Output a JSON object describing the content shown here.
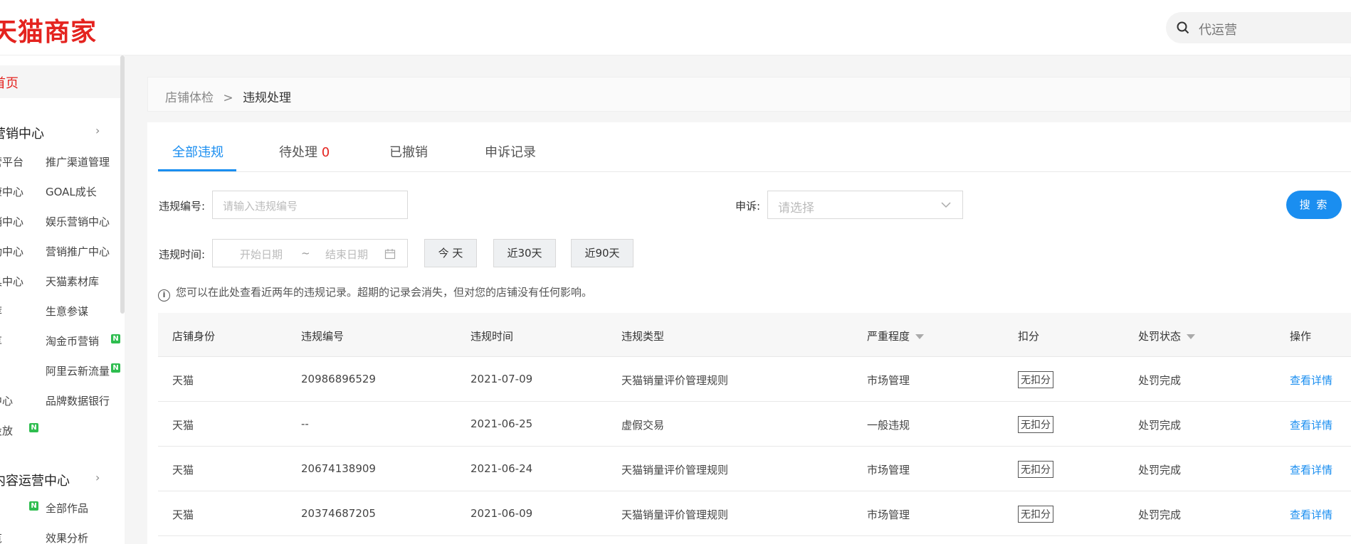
{
  "header": {
    "brand": "天猫商家",
    "search_placeholder": "代运营"
  },
  "sidebar": {
    "home": "首页",
    "marketing_center": "营销中心",
    "marketing_items": [
      "营平台",
      "推广渠道管理",
      "康中心",
      "GOAL成长",
      "销中心",
      "娱乐营销中心",
      "动中心",
      "营销推广中心",
      "具中心",
      "天猫素材库",
      "荐",
      "生意参谋",
      "享",
      "淘金币营销",
      "",
      "阿里云新流量",
      "中心",
      "品牌数据银行",
      "投放",
      ""
    ],
    "content_center": "内容运营中心",
    "content_items": [
      "全部作品",
      "览",
      "效果分析"
    ],
    "new_badge": "N"
  },
  "breadcrumb": {
    "parent": "店铺体检",
    "sep": ">",
    "current": "违规处理"
  },
  "tabs": {
    "all": "全部违规",
    "pending": "待处理",
    "pending_count": "0",
    "revoked": "已撤销",
    "appeal": "申诉记录"
  },
  "filters": {
    "id_label": "违规编号:",
    "id_placeholder": "请输入违规编号",
    "appeal_label": "申诉:",
    "appeal_placeholder": "请选择",
    "search_button": "搜 索",
    "time_label": "违规时间:",
    "start_placeholder": "开始日期",
    "range_sep": "~",
    "end_placeholder": "结束日期",
    "today": "今 天",
    "last30": "近30天",
    "last90": "近90天"
  },
  "tip": "您可以在此处查看近两年的违规记录。超期的记录会消失，但对您的店铺没有任何影响。",
  "table": {
    "headers": [
      "店铺身份",
      "违规编号",
      "违规时间",
      "违规类型",
      "严重程度",
      "扣分",
      "处罚状态",
      "操作"
    ],
    "rows": [
      {
        "shop": "天猫",
        "id": "20986896529",
        "time": "2021-07-09",
        "type": "天猫销量评价管理规则",
        "severity": "市场管理",
        "points": "无扣分",
        "status": "处罚完成",
        "action": "查看详情"
      },
      {
        "shop": "天猫",
        "id": "--",
        "time": "2021-06-25",
        "type": "虚假交易",
        "severity": "一般违规",
        "points": "无扣分",
        "status": "处罚完成",
        "action": "查看详情"
      },
      {
        "shop": "天猫",
        "id": "20674138909",
        "time": "2021-06-24",
        "type": "天猫销量评价管理规则",
        "severity": "市场管理",
        "points": "无扣分",
        "status": "处罚完成",
        "action": "查看详情"
      },
      {
        "shop": "天猫",
        "id": "20374687205",
        "time": "2021-06-09",
        "type": "天猫销量评价管理规则",
        "severity": "市场管理",
        "points": "无扣分",
        "status": "处罚完成",
        "action": "查看详情"
      }
    ]
  }
}
